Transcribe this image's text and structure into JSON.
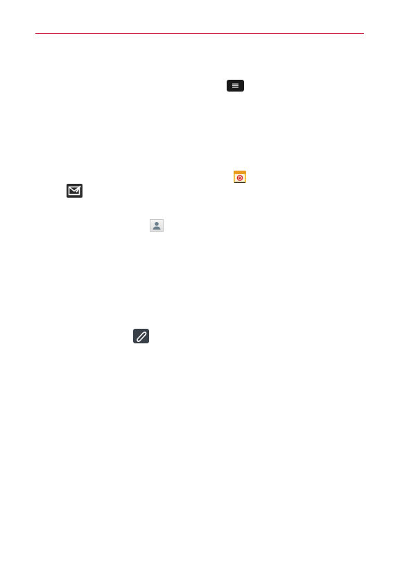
{
  "page": {
    "rule_color": "#c8102e"
  },
  "icons": {
    "menu_key": "menu-key-icon",
    "email_app": "email-app-icon",
    "compose": "compose-icon",
    "contact": "contact-icon",
    "attach": "attach-icon"
  }
}
